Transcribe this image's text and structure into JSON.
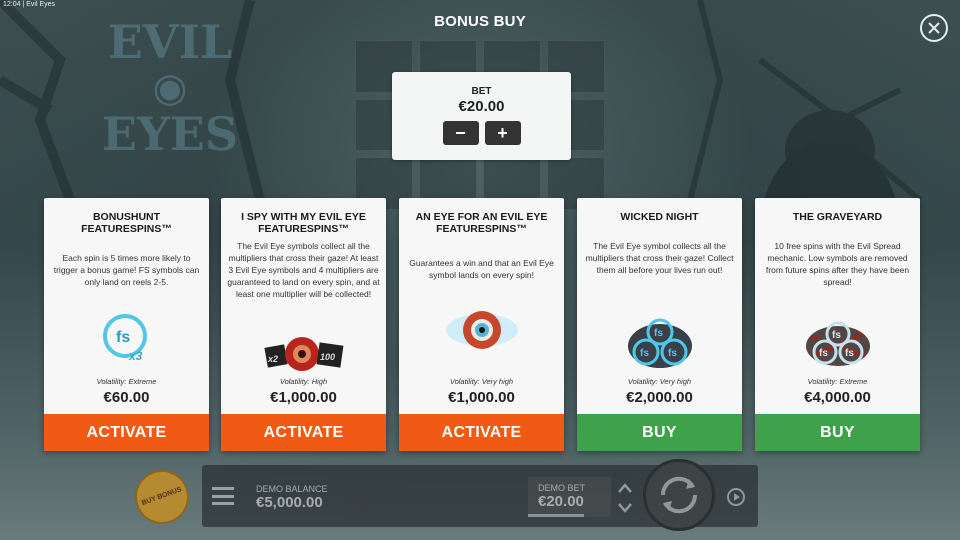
{
  "status_bar": {
    "time": "12:04",
    "app_name": "Evil Eyes"
  },
  "background": {
    "logo_lines": [
      "EVIL",
      "EYES"
    ]
  },
  "header": {
    "title": "BONUS BUY"
  },
  "bet": {
    "label": "BET",
    "value": "€20.00",
    "minus": "−",
    "plus": "+"
  },
  "cards": [
    {
      "title": "BONUSHUNT FEATURESPINS™",
      "description": "Each spin is 5 times more likely to trigger a bonus game! FS symbols can only land on reels 2-5.",
      "icon": "fs-x3-icon",
      "volatility": "Volatility: Extreme",
      "price": "€60.00",
      "button": "ACTIVATE",
      "button_color": "#f15a15"
    },
    {
      "title": "I SPY WITH MY EVIL EYE FEATURESPINS™",
      "description": "The Evil Eye symbols collect all the multipliers that cross their gaze! At least 3 Evil Eye symbols and 4 multipliers are guaranteed to land on every spin, and at least one multiplier will be collected!",
      "icon": "evil-eye-multiplier-icon",
      "volatility": "Volatility: High",
      "price": "€1,000.00",
      "button": "ACTIVATE",
      "button_color": "#f15a15",
      "icon_labels": [
        "x2",
        "100"
      ]
    },
    {
      "title": "AN EYE FOR AN EVIL EYE FEATURESPINS™",
      "description": "Guarantees a win and that an Evil Eye symbol lands on every spin!",
      "icon": "evil-eye-icon",
      "volatility": "Volatility: Very high",
      "price": "€1,000.00",
      "button": "ACTIVATE",
      "button_color": "#f15a15"
    },
    {
      "title": "WICKED NIGHT",
      "description": "The Evil Eye symbol collects all the multipliers that cross their gaze! Collect them all before your lives run out!",
      "icon": "fs-triple-blue-icon",
      "volatility": "Volatility: Very high",
      "price": "€2,000.00",
      "button": "BUY",
      "button_color": "#3fa24a"
    },
    {
      "title": "THE GRAVEYARD",
      "description": "10 free spins with the Evil Spread mechanic. Low symbols are removed from future spins after they have been spread!",
      "icon": "fs-triple-red-icon",
      "volatility": "Volatility: Extreme",
      "price": "€4,000.00",
      "button": "BUY",
      "button_color": "#3fa24a"
    }
  ],
  "bottom_bar": {
    "buy_bonus": "BUY BONUS",
    "balance_label": "DEMO BALANCE",
    "balance_value": "€5,000.00",
    "bet_label": "DEMO BET",
    "bet_value": "€20.00"
  }
}
